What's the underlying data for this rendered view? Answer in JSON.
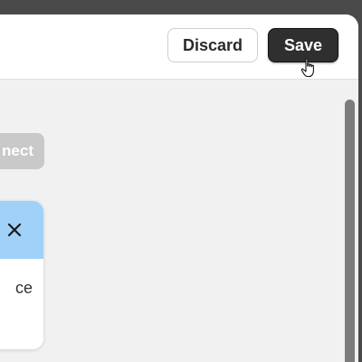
{
  "toolbar": {
    "discard_label": "Discard",
    "save_label": "Save"
  },
  "content": {
    "chip_label": "nect",
    "card_text": "ce"
  },
  "colors": {
    "chrome": "#4a4a4a",
    "panel_bg": "#f1f1f1",
    "save_bg": "#2f2f2f",
    "card_header": "#9fd1f9",
    "chip_bg": "#c9c9c9",
    "scrollbar": "#7c7c7c"
  }
}
